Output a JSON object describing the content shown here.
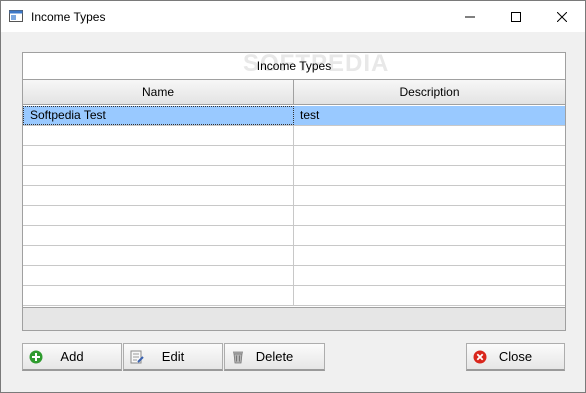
{
  "window": {
    "title": "Income Types"
  },
  "grid": {
    "caption": "Income Types",
    "watermark": "SOFTPEDIA",
    "columns": [
      "Name",
      "Description"
    ],
    "rows": [
      {
        "name": "Softpedia Test",
        "description": "test",
        "selected": true
      },
      {
        "name": "",
        "description": ""
      },
      {
        "name": "",
        "description": ""
      },
      {
        "name": "",
        "description": ""
      },
      {
        "name": "",
        "description": ""
      },
      {
        "name": "",
        "description": ""
      },
      {
        "name": "",
        "description": ""
      },
      {
        "name": "",
        "description": ""
      },
      {
        "name": "",
        "description": ""
      },
      {
        "name": "",
        "description": ""
      }
    ]
  },
  "buttons": {
    "add": "Add",
    "edit": "Edit",
    "delete": "Delete",
    "close": "Close"
  },
  "colors": {
    "selection": "#99c9ff",
    "add_icon": "#2e9b2e",
    "close_icon": "#d9261c"
  }
}
